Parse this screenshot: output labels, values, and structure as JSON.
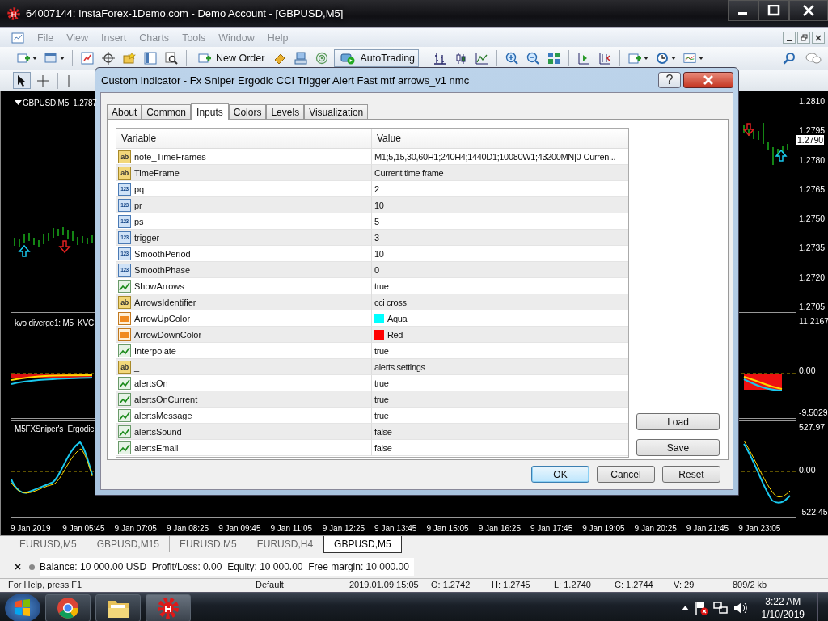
{
  "window": {
    "title": "64007144: InstaForex-1Demo.com - Demo Account - [GBPUSD,M5]"
  },
  "menu": [
    "File",
    "View",
    "Insert",
    "Charts",
    "Tools",
    "Window",
    "Help"
  ],
  "toolbar": {
    "new_order": "New Order",
    "autotrading": "AutoTrading"
  },
  "chart": {
    "panes": [
      {
        "label": "GBPUSD,M5  1.2787",
        "axis": [
          {
            "label": "1.2810",
            "highlighted": false
          },
          {
            "label": "1.2795",
            "highlighted": false
          },
          {
            "label": "1.2790",
            "highlighted": true
          },
          {
            "label": "1.2780",
            "highlighted": false
          },
          {
            "label": "1.2765",
            "highlighted": false
          },
          {
            "label": "1.2750",
            "highlighted": false
          },
          {
            "label": "1.2735",
            "highlighted": false
          },
          {
            "label": "1.2720",
            "highlighted": false
          },
          {
            "label": "1.2705",
            "highlighted": false
          }
        ]
      },
      {
        "label": "kvo diverge1: M5  KVC",
        "axis": [
          {
            "label": "11.2167",
            "highlighted": false
          },
          {
            "label": "0.00",
            "highlighted": false
          },
          {
            "label": "-9.5029",
            "highlighted": false
          }
        ]
      },
      {
        "label": "M5FXSniper's_Ergodic",
        "axis": [
          {
            "label": "527.97",
            "highlighted": false
          },
          {
            "label": "0.00",
            "highlighted": false
          },
          {
            "label": "-522.45",
            "highlighted": false
          }
        ]
      }
    ],
    "time_axis": [
      "9 Jan 2019",
      "9 Jan 05:45",
      "9 Jan 07:05",
      "9 Jan 08:25",
      "9 Jan 09:45",
      "9 Jan 11:05",
      "9 Jan 12:25",
      "9 Jan 13:45",
      "9 Jan 15:05",
      "9 Jan 16:25",
      "9 Jan 17:45",
      "9 Jan 19:05",
      "9 Jan 20:25",
      "9 Jan 21:45",
      "9 Jan 23:05"
    ]
  },
  "chart_tabs": [
    {
      "label": "EURUSD,M5",
      "selected": false
    },
    {
      "label": "GBPUSD,M15",
      "selected": false
    },
    {
      "label": "EURUSD,M5",
      "selected": false
    },
    {
      "label": "EURUSD,H4",
      "selected": false
    },
    {
      "label": "GBPUSD,M5",
      "selected": true
    }
  ],
  "terminal": {
    "summary": "Balance: 10 000.00 USD  Profit/Loss: 0.00  Equity: 10 000.00  Free margin: 10 000.00"
  },
  "status_bar": [
    "For Help, press F1",
    "Default",
    "2019.01.09 15:05",
    "O: 1.2742",
    "H: 1.2745",
    "L: 1.2740",
    "C: 1.2744",
    "V: 29",
    "809/2 kb"
  ],
  "taskbar": {
    "time": "3:22 AM",
    "date": "1/10/2019"
  },
  "dialog": {
    "title": "Custom Indicator - Fx Sniper Ergodic CCI Trigger Alert Fast mtf arrows_v1 nmc",
    "help": "?",
    "tabs": [
      {
        "label": "About",
        "selected": false
      },
      {
        "label": "Common",
        "selected": false
      },
      {
        "label": "Inputs",
        "selected": true
      },
      {
        "label": "Colors",
        "selected": false
      },
      {
        "label": "Levels",
        "selected": false
      },
      {
        "label": "Visualization",
        "selected": false
      }
    ],
    "columns": [
      "Variable",
      "Value"
    ],
    "rows": [
      {
        "kind": "string",
        "badge": "ab",
        "variable": "note_TimeFrames",
        "value": "M1;5,15,30,60H1;240H4;1440D1;10080W1;43200MN|0-Curren..."
      },
      {
        "kind": "string",
        "badge": "ab",
        "variable": "TimeFrame",
        "value": "Current time frame"
      },
      {
        "kind": "int",
        "badge": "123",
        "variable": "pq",
        "value": "2"
      },
      {
        "kind": "int",
        "badge": "123",
        "variable": "pr",
        "value": "10"
      },
      {
        "kind": "int",
        "badge": "123",
        "variable": "ps",
        "value": "5"
      },
      {
        "kind": "int",
        "badge": "123",
        "variable": "trigger",
        "value": "3"
      },
      {
        "kind": "int",
        "badge": "123",
        "variable": "SmoothPeriod",
        "value": "10"
      },
      {
        "kind": "int",
        "badge": "123",
        "variable": "SmoothPhase",
        "value": "0"
      },
      {
        "kind": "bool",
        "variable": "ShowArrows",
        "value": "true"
      },
      {
        "kind": "string",
        "badge": "ab",
        "variable": "ArrowsIdentifier",
        "value": "cci cross"
      },
      {
        "kind": "color",
        "variable": "ArrowUpColor",
        "value": "Aqua",
        "color": "#00ffff"
      },
      {
        "kind": "color",
        "variable": "ArrowDownColor",
        "value": "Red",
        "color": "#ff0000"
      },
      {
        "kind": "bool",
        "variable": "Interpolate",
        "value": "true"
      },
      {
        "kind": "string",
        "badge": "ab",
        "variable": "_",
        "value": "alerts settings"
      },
      {
        "kind": "bool",
        "variable": "alertsOn",
        "value": "true"
      },
      {
        "kind": "bool",
        "variable": "alertsOnCurrent",
        "value": "true"
      },
      {
        "kind": "bool",
        "variable": "alertsMessage",
        "value": "true"
      },
      {
        "kind": "bool",
        "variable": "alertsSound",
        "value": "false"
      },
      {
        "kind": "bool",
        "variable": "alertsEmail",
        "value": "false"
      }
    ],
    "side_buttons": [
      "Load",
      "Save"
    ],
    "buttons": [
      "OK",
      "Cancel",
      "Reset"
    ]
  }
}
